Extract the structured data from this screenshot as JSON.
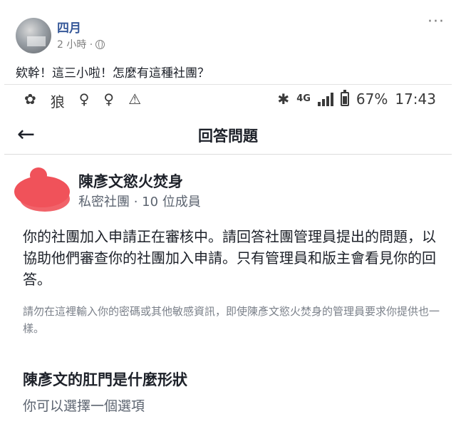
{
  "post": {
    "author": "四月",
    "time": "2 小時 ·",
    "more_label": "···",
    "text": "欸幹！這三小啦！怎麼有這種社團？"
  },
  "status_bar": {
    "left_icons": [
      "hops-icon",
      "pig-icon",
      "female-icon",
      "female-icon",
      "warning-icon"
    ],
    "left_glyphs": [
      "✿",
      "狼",
      "♀",
      "♀",
      "⚠"
    ],
    "bluetooth": "✱",
    "network": "4G",
    "battery": "67%",
    "battery_level": 0.67,
    "clock": "17:43"
  },
  "nav": {
    "back_label": "←",
    "title": "回答問題"
  },
  "group": {
    "name": "陳彥文慾火焚身",
    "subtitle": "私密社團 · 10 位成員"
  },
  "intro_text": "你的社團加入申請正在審核中。請回答社團管理員提出的問題，以協助他們審查你的社團加入申請。只有管理員和版主會看見你的回答。",
  "notice_text": "請勿在這裡輸入你的密碼或其他敏感資訊，即使陳彥文慾火焚身的管理員要求你提供也一樣。",
  "question": {
    "title": "陳彥文的肛門是什麼形狀",
    "hint": "你可以選擇一個選項"
  }
}
